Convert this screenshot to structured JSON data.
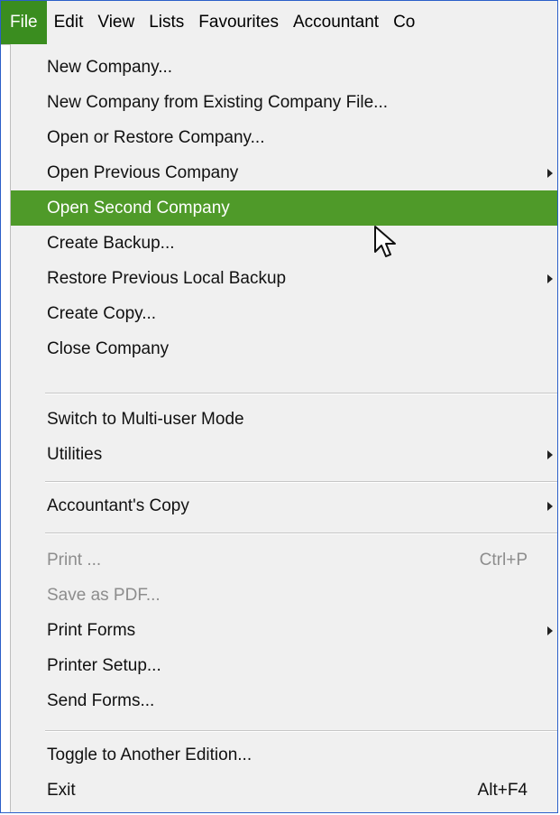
{
  "menubar": {
    "items": [
      {
        "label": "File"
      },
      {
        "label": "Edit"
      },
      {
        "label": "View"
      },
      {
        "label": "Lists"
      },
      {
        "label": "Favourites"
      },
      {
        "label": "Accountant"
      },
      {
        "label": "Co"
      }
    ]
  },
  "file_menu": {
    "items": [
      {
        "label": "New Company..."
      },
      {
        "label": "New Company from Existing Company File..."
      },
      {
        "label": "Open or Restore Company..."
      },
      {
        "label": "Open Previous Company"
      },
      {
        "label": "Open Second Company"
      },
      {
        "label": "Create Backup..."
      },
      {
        "label": "Restore Previous Local Backup"
      },
      {
        "label": "Create Copy..."
      },
      {
        "label": "Close Company"
      },
      {
        "label": "Switch to Multi-user Mode"
      },
      {
        "label": "Utilities"
      },
      {
        "label": "Accountant's Copy"
      },
      {
        "label": "Print ...",
        "shortcut": "Ctrl+P"
      },
      {
        "label": "Save as PDF..."
      },
      {
        "label": "Print Forms"
      },
      {
        "label": "Printer Setup..."
      },
      {
        "label": "Send Forms..."
      },
      {
        "label": "Toggle to Another Edition..."
      },
      {
        "label": "Exit",
        "shortcut": "Alt+F4"
      }
    ]
  },
  "colors": {
    "active_menu": "#3a8d1f",
    "hover_item": "#4f9a29",
    "window_border": "#2b5fc9"
  },
  "icons": [
    "submenu-arrow-icon",
    "mouse-pointer-icon"
  ]
}
